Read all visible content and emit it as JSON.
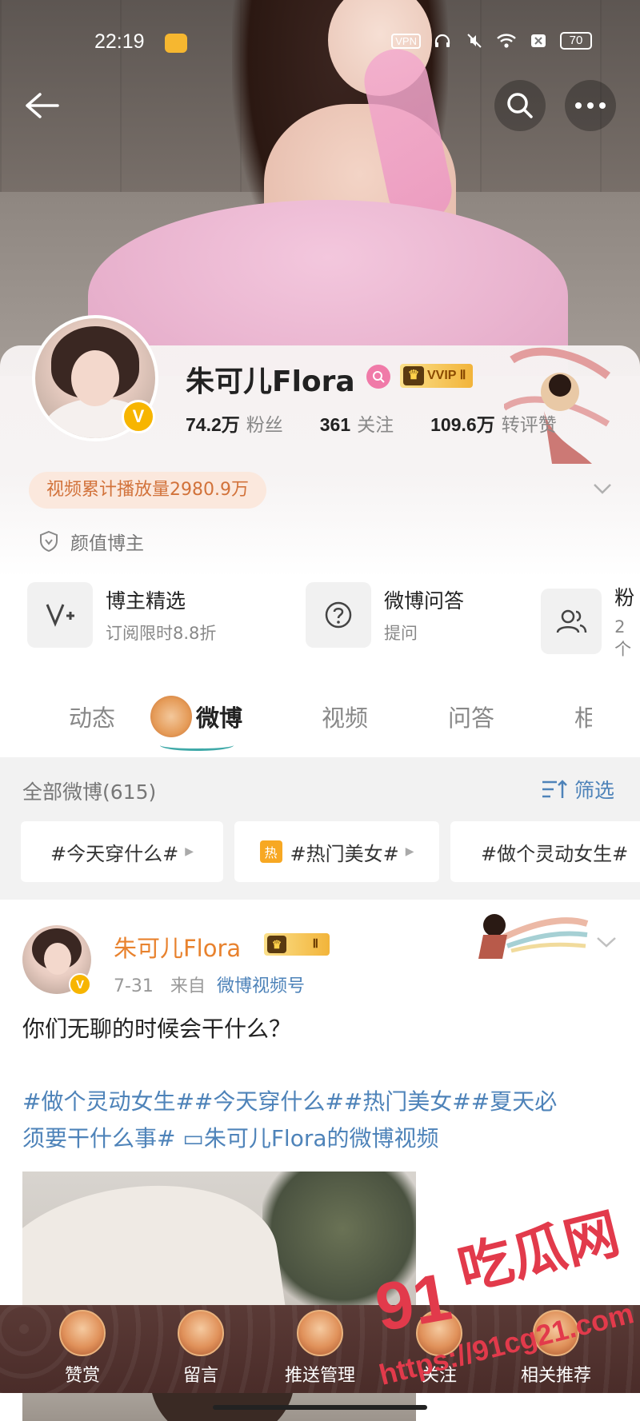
{
  "status_bar": {
    "time": "22:19",
    "vpn": "VPN",
    "battery": "70"
  },
  "profile": {
    "name": "朱可儿Flora",
    "vip_label": "VVIP Ⅱ",
    "verified_mark": "V",
    "stats": [
      {
        "value": "74.2万",
        "label": "粉丝"
      },
      {
        "value": "361",
        "label": "关注"
      },
      {
        "value": "109.6万",
        "label": "转评赞"
      }
    ],
    "play_count": "视频累计播放量2980.9万",
    "tag": "颜值博主"
  },
  "features": [
    {
      "icon": "v-plus-icon",
      "title": "博主精选",
      "subtitle": "订阅限时8.8折"
    },
    {
      "icon": "question-icon",
      "title": "微博问答",
      "subtitle": "提问"
    },
    {
      "icon": "fans-group-icon",
      "title": "粉",
      "subtitle": "2个"
    }
  ],
  "tabs": [
    {
      "label": "动态",
      "active": false
    },
    {
      "label": "微博",
      "active": true
    },
    {
      "label": "视频",
      "active": false
    },
    {
      "label": "问答",
      "active": false
    },
    {
      "label": "相",
      "active": false
    }
  ],
  "filter": {
    "count_label": "全部微博(615)",
    "filter_label": "筛选",
    "chips": [
      {
        "label": "#今天穿什么#",
        "hot": false
      },
      {
        "label": "#热门美女#",
        "hot": true,
        "hot_mark": "热"
      },
      {
        "label": "#做个灵动女生#",
        "hot": false
      }
    ]
  },
  "post": {
    "author": "朱可儿Flora",
    "vip_label": "Ⅱ",
    "date": "7-31",
    "from_prefix": "来自",
    "source": "微博视频号",
    "text": "你们无聊的时候会干什么？",
    "tags_line1": "#做个灵动女生##今天穿什么##热门美女##夏天必",
    "tags_line2": "须要干什么事# ▭朱可儿Flora的微博视频"
  },
  "bottom_nav": [
    {
      "label": "赞赏"
    },
    {
      "label": "留言"
    },
    {
      "label": "推送管理"
    },
    {
      "label": "关注"
    },
    {
      "label": "相关推荐"
    }
  ],
  "watermark": {
    "brand": "吃瓜网",
    "number": "91",
    "url": "https://91cg21.com"
  },
  "colors": {
    "accent_orange": "#e8822e",
    "link_blue": "#4e83b9",
    "vip_gold": "#f2b43a",
    "watermark_red": "#e23a4b",
    "nav_bg": "#4a2c29"
  }
}
